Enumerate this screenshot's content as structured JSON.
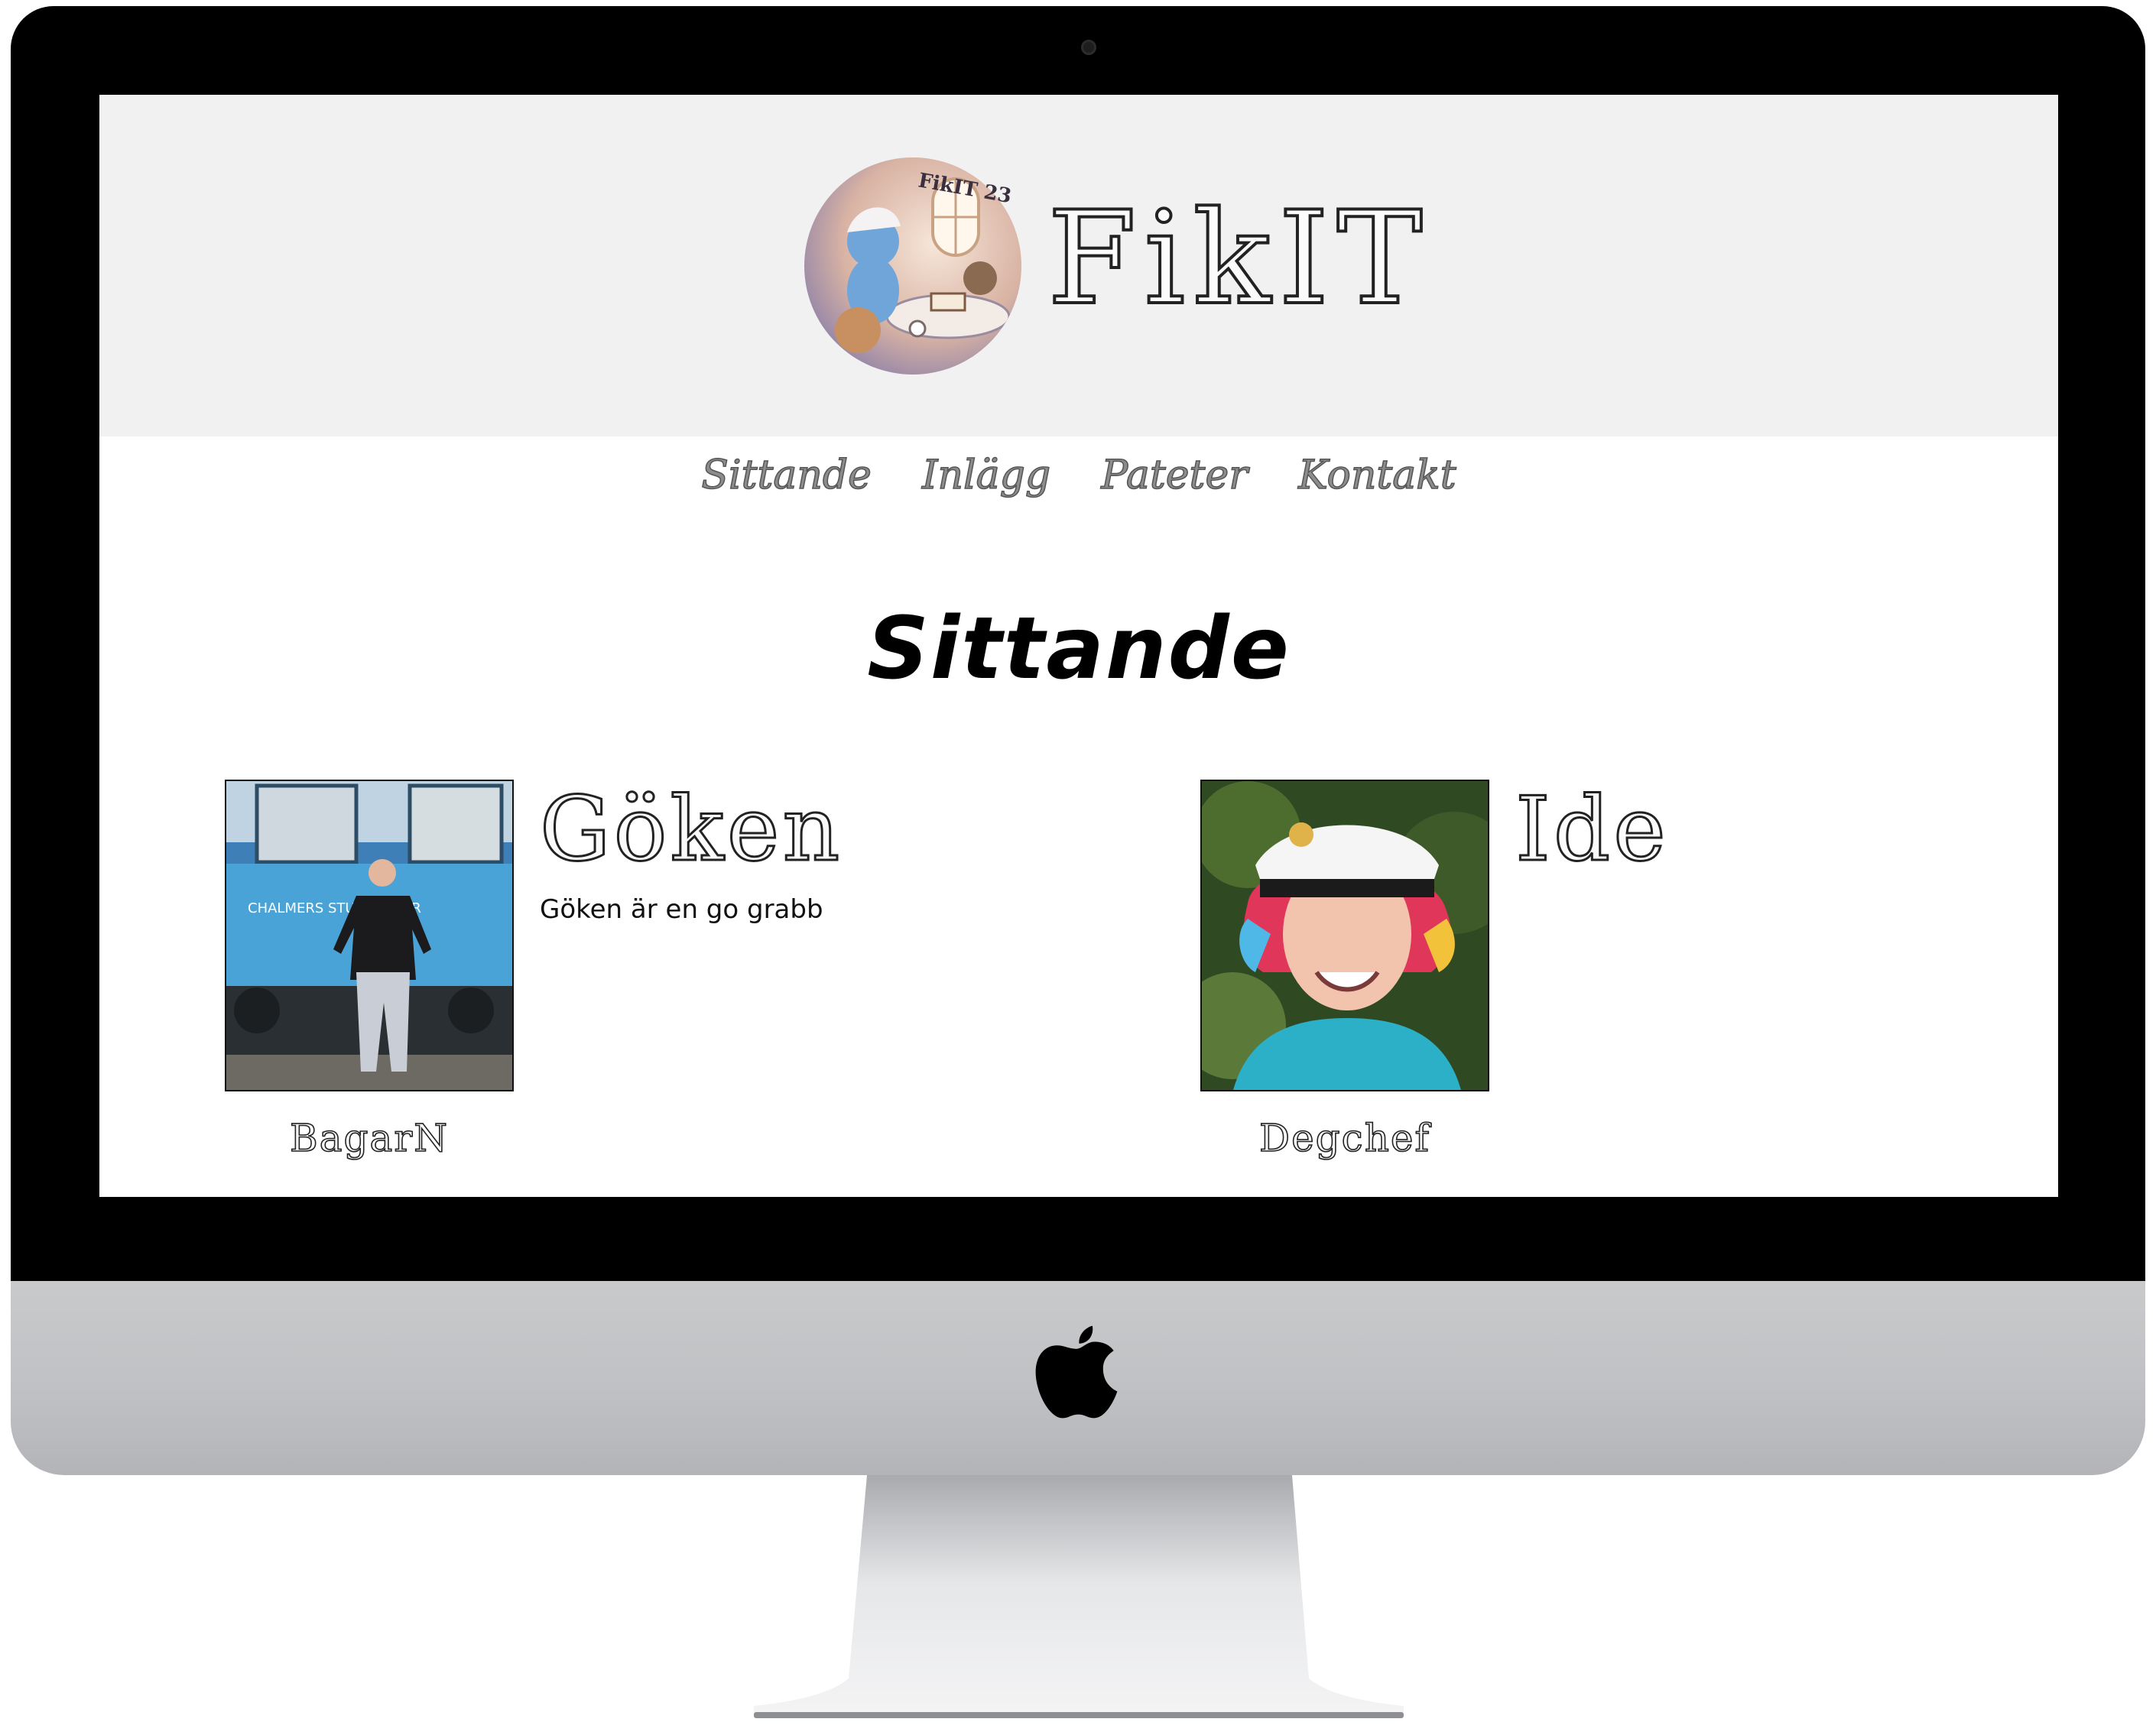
{
  "site": {
    "title": "FikIT",
    "logo_text": "FikIT 23"
  },
  "nav": {
    "items": [
      {
        "label": "Sittande"
      },
      {
        "label": "Inlägg"
      },
      {
        "label": "Pateter"
      },
      {
        "label": "Kontakt"
      }
    ]
  },
  "page": {
    "title": "Sittande"
  },
  "members": [
    {
      "name": "Göken",
      "description": "Göken är en go grabb",
      "role": "BagarN",
      "photo_text": "CHALMERS STUDENTKÅR"
    },
    {
      "name": "Ide",
      "description": "",
      "role": "Degchef"
    }
  ],
  "colors": {
    "header_bg": "#f1f1f1",
    "nav_text": "#8c8c8c",
    "title_text": "#000000"
  }
}
